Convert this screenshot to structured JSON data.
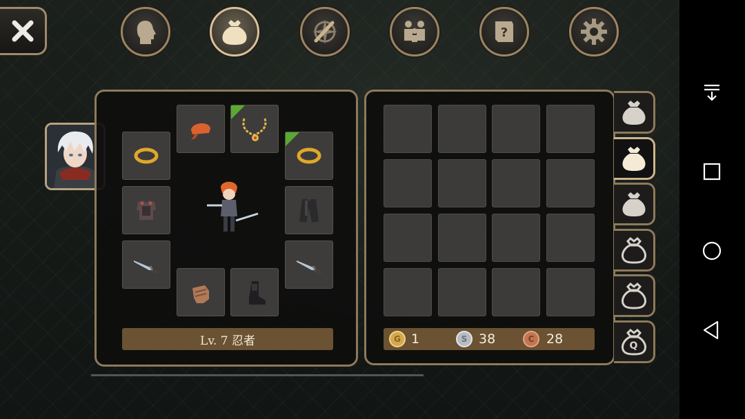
{
  "top_tabs": [
    {
      "icon": "head-icon",
      "active": false
    },
    {
      "icon": "bag-icon",
      "active": true
    },
    {
      "icon": "sword-compass-icon",
      "active": false
    },
    {
      "icon": "party-icon",
      "active": false
    },
    {
      "icon": "quest-scroll-icon",
      "active": false
    },
    {
      "icon": "gear-icon",
      "active": false
    }
  ],
  "character": {
    "level_text": "Lv. 7 忍者"
  },
  "equipment": {
    "slots": [
      {
        "name": "head",
        "item": "bandana",
        "new": false
      },
      {
        "name": "neck",
        "item": "necklace",
        "new": true
      },
      {
        "name": "ring-left",
        "item": "gold-ring",
        "new": false
      },
      {
        "name": "ring-right",
        "item": "gold-ring",
        "new": true
      },
      {
        "name": "body",
        "item": "armor",
        "new": false
      },
      {
        "name": "cloak",
        "item": "coat",
        "new": false
      },
      {
        "name": "weapon-left",
        "item": "dagger",
        "new": false
      },
      {
        "name": "weapon-right",
        "item": "dagger",
        "new": false
      },
      {
        "name": "hands",
        "item": "gloves",
        "new": false
      },
      {
        "name": "feet",
        "item": "boots",
        "new": false
      }
    ]
  },
  "inventory": {
    "rows": 4,
    "cols": 4
  },
  "currency": {
    "gold": {
      "letter": "G",
      "value": "1"
    },
    "silver": {
      "letter": "S",
      "value": "38"
    },
    "copper": {
      "letter": "C",
      "value": "28"
    }
  },
  "bag_tabs": [
    {
      "label": "",
      "active": false
    },
    {
      "label": "",
      "active": true
    },
    {
      "label": "",
      "active": false
    },
    {
      "label": "",
      "active": false
    },
    {
      "label": "",
      "active": false
    },
    {
      "label": "Q",
      "active": false
    }
  ],
  "colors": {
    "frame": "#8e7a5b",
    "slot": "#3d3c3a",
    "bar": "#6a5232",
    "gold": "#d5a84c",
    "silver": "#b8bcc2",
    "copper": "#c27552"
  }
}
